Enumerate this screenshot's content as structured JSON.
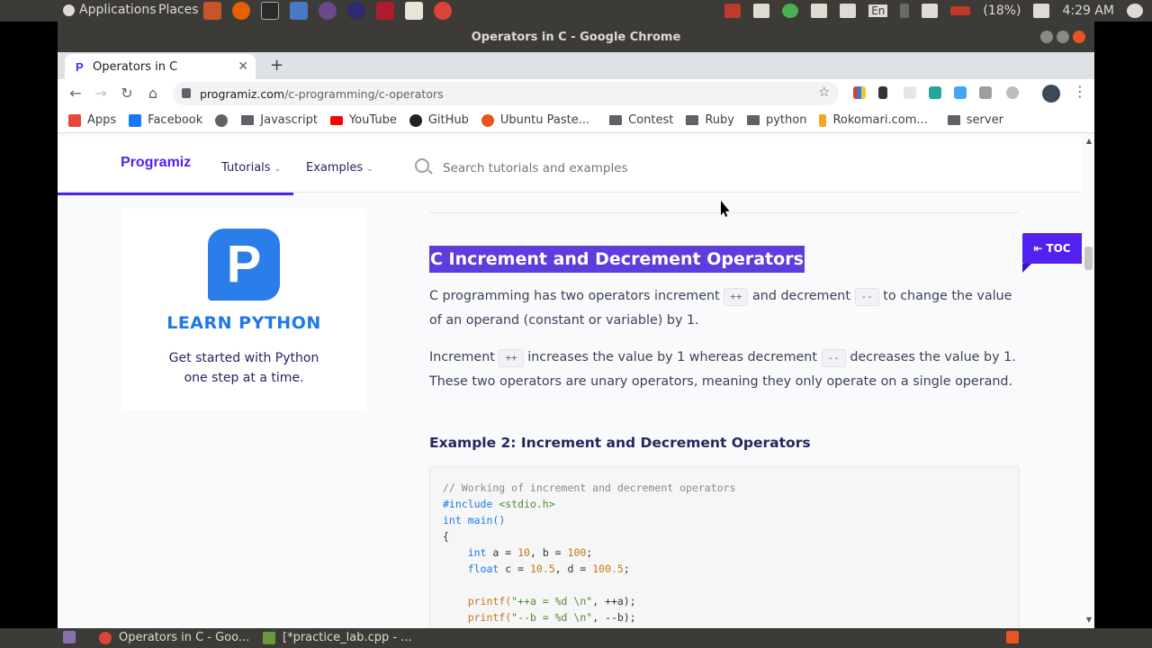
{
  "os_top": {
    "applications_label": "Applications",
    "places_label": "Places",
    "battery_text": "(18%)",
    "clock": "4:29 AM",
    "keyboard_layout": "En"
  },
  "window": {
    "title": "Operators in C - Google Chrome"
  },
  "tabs": [
    {
      "label": "Operators in C"
    }
  ],
  "address_bar": {
    "host": "programiz.com",
    "path": "/c-programming/c-operators"
  },
  "bookmarks": [
    {
      "label": "Apps",
      "icon": "apps-grid-icon",
      "color": "#e8453c"
    },
    {
      "label": "Facebook",
      "icon": "facebook-icon",
      "color": "#1877f2"
    },
    {
      "label": "",
      "icon": "globe-icon",
      "color": "#5f6368"
    },
    {
      "label": "Javascript",
      "icon": "folder-icon",
      "color": "#5f6368"
    },
    {
      "label": "YouTube",
      "icon": "youtube-icon",
      "color": "#ff0000"
    },
    {
      "label": "GitHub",
      "icon": "github-icon",
      "color": "#202124"
    },
    {
      "label": "Ubuntu Paste...",
      "icon": "ubuntu-icon",
      "color": "#e95420"
    },
    {
      "label": "Contest",
      "icon": "folder-icon",
      "color": "#5f6368"
    },
    {
      "label": "Ruby",
      "icon": "folder-icon",
      "color": "#5f6368"
    },
    {
      "label": "python",
      "icon": "folder-icon",
      "color": "#5f6368"
    },
    {
      "label": "Rokomari.com...",
      "icon": "rokomari-icon",
      "color": "#f5a623"
    },
    {
      "label": "server",
      "icon": "folder-icon",
      "color": "#5f6368"
    }
  ],
  "site": {
    "logo": "Programiz",
    "nav": {
      "tutorials": "Tutorials",
      "examples": "Examples"
    },
    "search_placeholder": "Search tutorials and examples",
    "toc_label": "TOC"
  },
  "promo": {
    "logo_letter": "P",
    "title": "LEARN PYTHON",
    "text_line1": "Get started with Python",
    "text_line2": "one step at a time."
  },
  "article": {
    "heading": "C Increment and Decrement Operators",
    "p1": {
      "a": "C programming has two operators increment",
      "chip1": "++",
      "b": "and decrement",
      "chip2": "--",
      "c": "to change the value of an operand (constant or variable) by 1."
    },
    "p2": {
      "a": "Increment",
      "chip1": "++",
      "b": "increases the value by 1 whereas decrement",
      "chip2": "--",
      "c": "decreases the value by 1. These two operators are unary operators, meaning they only operate on a single operand."
    },
    "example_heading": "Example 2: Increment and Decrement Operators",
    "code": {
      "comment": "// Working of increment and decrement operators",
      "include_kw": "#include",
      "include_hdr": "<stdio.h>",
      "main_type": "int",
      "main_name": "main()",
      "open_brace": "{",
      "l1_type": "int",
      "l1_rest_a": "a = ",
      "l1_n1": "10",
      "l1_rest_b": ", b = ",
      "l1_n2": "100",
      "l1_end": ";",
      "l2_type": "float",
      "l2_rest_a": "c = ",
      "l2_n1": "10.5",
      "l2_rest_b": ", d = ",
      "l2_n2": "100.5",
      "l2_end": ";",
      "l3_fn": "printf(",
      "l3_str": "\"++a = %d \\n\"",
      "l3_rest": ", ++a);",
      "l4_fn": "printf(",
      "l4_str": "\"--b = %d \\n\"",
      "l4_rest": ", --b);"
    }
  },
  "taskbar": {
    "items": [
      {
        "label": "Operators in C - Goo..."
      },
      {
        "label": "[*practice_lab.cpp - ..."
      }
    ]
  },
  "colors": {
    "brand": "#5221f0",
    "selection": "#5d3ddb",
    "ubuntu_orange": "#e95420"
  }
}
